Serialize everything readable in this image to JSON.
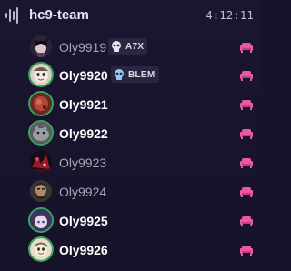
{
  "channel": {
    "name": "hc9-team",
    "timer": "4:12:11",
    "icon": "voice-channel-icon"
  },
  "colors": {
    "background": "#17132a",
    "speaking_ring": "#3aa55d",
    "activity_icon": "#e85aa2",
    "idle_text": "#a7a4b4"
  },
  "members": [
    {
      "name": "Oly9919",
      "active": false,
      "speaking": false,
      "tag": "A7X",
      "tag_icon": "skull-icon",
      "avatar": "anime-dark-avatar",
      "activity_icon": "couch-icon"
    },
    {
      "name": "Oly9920",
      "active": true,
      "speaking": true,
      "tag": "BLEM",
      "tag_icon": "skull-icon",
      "avatar": "cartoon-cream-avatar",
      "activity_icon": "couch-icon"
    },
    {
      "name": "Oly9921",
      "active": true,
      "speaking": true,
      "tag": "",
      "tag_icon": "",
      "avatar": "red-orb-avatar",
      "activity_icon": "couch-icon"
    },
    {
      "name": "Oly9922",
      "active": true,
      "speaking": true,
      "tag": "",
      "tag_icon": "",
      "avatar": "grey-creature-avatar",
      "activity_icon": "couch-icon"
    },
    {
      "name": "Oly9923",
      "active": false,
      "speaking": false,
      "tag": "",
      "tag_icon": "",
      "avatar": "red-black-avatar",
      "activity_icon": "couch-icon"
    },
    {
      "name": "Oly9924",
      "active": false,
      "speaking": false,
      "tag": "",
      "tag_icon": "",
      "avatar": "bearded-man-avatar",
      "activity_icon": "couch-icon"
    },
    {
      "name": "Oly9925",
      "active": true,
      "speaking": true,
      "tag": "",
      "tag_icon": "",
      "avatar": "anime-purple-avatar",
      "activity_icon": "couch-icon"
    },
    {
      "name": "Oly9926",
      "active": true,
      "speaking": true,
      "tag": "",
      "tag_icon": "",
      "avatar": "cartoon-face-avatar",
      "activity_icon": "couch-icon"
    }
  ]
}
